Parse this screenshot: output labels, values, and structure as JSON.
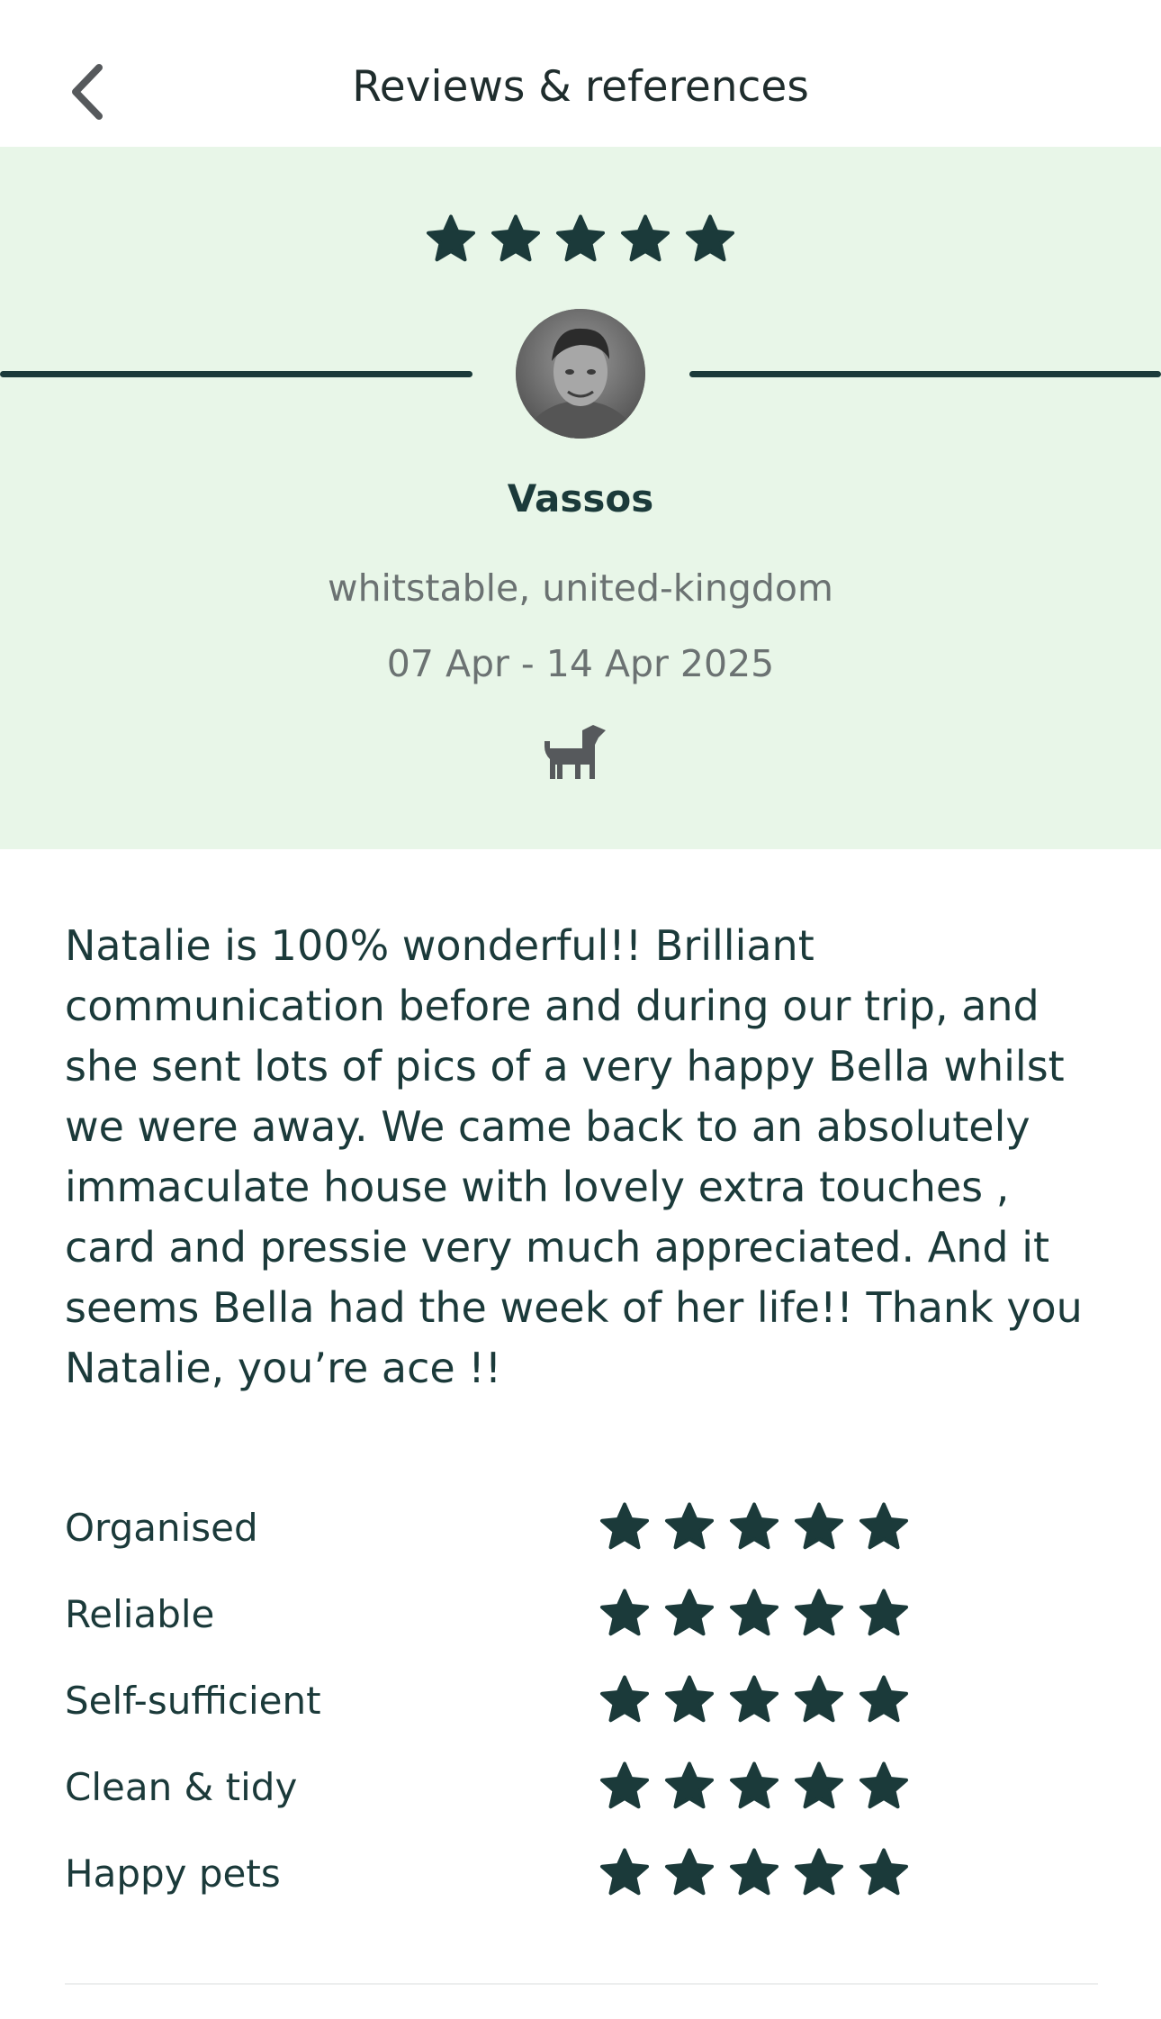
{
  "header": {
    "title": "Reviews & references",
    "back_icon": "chevron-left-icon"
  },
  "review": {
    "overall_rating": 5,
    "rating_max": 5,
    "star_color": "#1b3a3a",
    "hero_background": "#e8f6e8",
    "reviewer": {
      "name": "Vassos",
      "location": "whitstable, united-kingdom",
      "dates": "07 Apr - 14 Apr 2025",
      "pet_icon": "dog-icon"
    },
    "text": "Natalie is 100% wonderful!! Brilliant communication before and during our trip, and she sent lots of pics of a very happy Bella whilst we were away. We came back to an absolutely immaculate house with lovely extra touches , card and pressie very much appreciated. And it seems Bella had the week of her life!! Thank you Natalie, you’re ace !!"
  },
  "ratings": [
    {
      "label": "Organised",
      "stars": 5
    },
    {
      "label": "Reliable",
      "stars": 5
    },
    {
      "label": "Self-sufficient",
      "stars": 5
    },
    {
      "label": "Clean & tidy",
      "stars": 5
    },
    {
      "label": "Happy pets",
      "stars": 5
    }
  ]
}
